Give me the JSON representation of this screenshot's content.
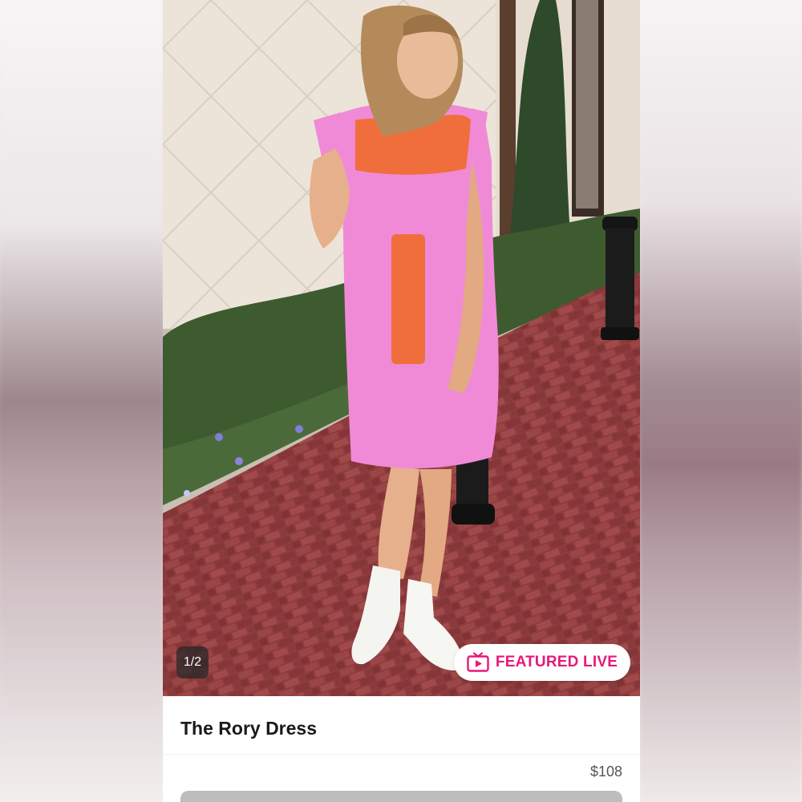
{
  "gallery": {
    "counter": "1/2"
  },
  "badge": {
    "label": "FEATURED LIVE",
    "icon": "tv-play-icon",
    "color": "#e5197b"
  },
  "product": {
    "title": "The Rory Dress",
    "price": "$108"
  },
  "colors": {
    "dress": "#f08ad6",
    "embroidery": "#f06a2b",
    "brick": "#8f3c3e"
  }
}
